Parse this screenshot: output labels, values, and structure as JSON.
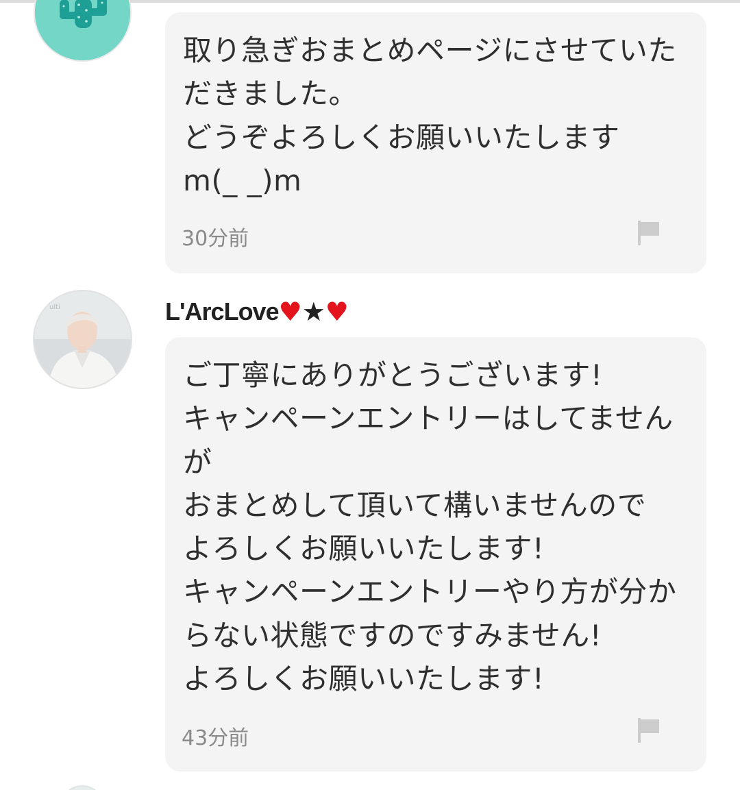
{
  "comments": [
    {
      "message": "取り急ぎおまとめページにさせていただきました。\nどうぞよろしくお願いいたします\nm(_ _)m",
      "timestamp": "30分前"
    },
    {
      "username": "L'ArcLove",
      "username_decorations": [
        "♥",
        "★",
        "♥"
      ],
      "message": "ご丁寧にありがとうございます!\nキャンペーンエントリーはしてませんが\nおまとめして頂いて構いませんので\nよろしくお願いいたします!\nキャンペーンエントリーやり方が分からない状態ですのですみません!\nよろしくお願いいたします!",
      "timestamp": "43分前"
    }
  ],
  "icons": {
    "report": "flag-icon",
    "avatar_1": "cactus-avatar",
    "avatar_2": "user-photo-avatar"
  },
  "colors": {
    "bubble_background": "#f4f4f4",
    "text": "#2f2f2f",
    "timestamp": "#8a8a8a",
    "heart": "#e3141c",
    "avatar_1": "#73d6c7"
  }
}
